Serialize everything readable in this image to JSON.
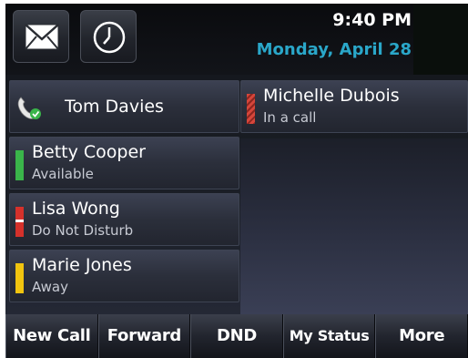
{
  "header": {
    "time": "9:40 PM",
    "date": "Monday, April 28",
    "buttons": [
      {
        "icon": "envelope-icon"
      },
      {
        "icon": "clock-icon"
      }
    ]
  },
  "lines": [
    {
      "name": "Tom Davies",
      "status": "",
      "icon": "handset-icon"
    },
    {
      "name": "Betty Cooper",
      "status": "Available",
      "indicator": "green"
    },
    {
      "name": "Lisa Wong",
      "status": "Do Not Disturb",
      "indicator": "red"
    },
    {
      "name": "Marie Jones",
      "status": "Away",
      "indicator": "yellow"
    },
    {
      "name": "Michelle Dubois",
      "status": "In a call",
      "indicator": "red-striped"
    }
  ],
  "softkeys": [
    "New Call",
    "Forward",
    "DND",
    "My Status",
    "More"
  ],
  "colors": {
    "date": "#2aa7c9",
    "available": "#3ab54a",
    "dnd": "#d5312b",
    "away": "#f1c40f"
  }
}
